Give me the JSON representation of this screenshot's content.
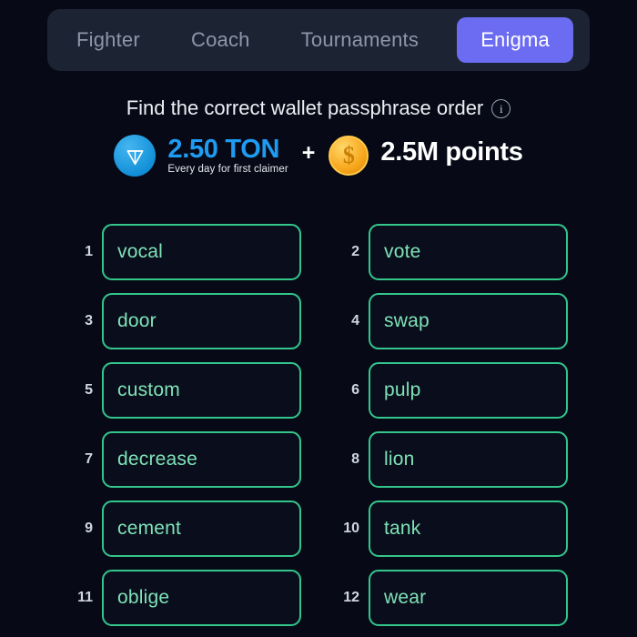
{
  "tabs": [
    {
      "label": "Fighter",
      "active": false
    },
    {
      "label": "Coach",
      "active": false
    },
    {
      "label": "Tournaments",
      "active": false
    },
    {
      "label": "Enigma",
      "active": true
    }
  ],
  "heading": {
    "text": "Find the correct wallet passphrase order",
    "info_icon": "info-icon"
  },
  "reward": {
    "ton_icon": "ton-logo-icon",
    "ton_amount": "2.50 TON",
    "ton_subtitle": "Every day for first claimer",
    "plus": "+",
    "coin_icon": "dollar-coin-icon",
    "coin_glyph": "$",
    "points": "2.5M points"
  },
  "words": [
    {
      "index": "1",
      "word": "vocal"
    },
    {
      "index": "2",
      "word": "vote"
    },
    {
      "index": "3",
      "word": "door"
    },
    {
      "index": "4",
      "word": "swap"
    },
    {
      "index": "5",
      "word": "custom"
    },
    {
      "index": "6",
      "word": "pulp"
    },
    {
      "index": "7",
      "word": "decrease"
    },
    {
      "index": "8",
      "word": "lion"
    },
    {
      "index": "9",
      "word": "cement"
    },
    {
      "index": "10",
      "word": "tank"
    },
    {
      "index": "11",
      "word": "oblige"
    },
    {
      "index": "12",
      "word": "wear"
    }
  ],
  "colors": {
    "background": "#070a16",
    "tabbar": "#1c2433",
    "active_tab": "#6c6cf2",
    "inactive_tab_text": "#8d96a9",
    "ton_blue": "#1e9cf2",
    "cell_border": "#33c68c",
    "cell_text": "#7fe3b8",
    "coin_gold": "#f7a61c"
  }
}
